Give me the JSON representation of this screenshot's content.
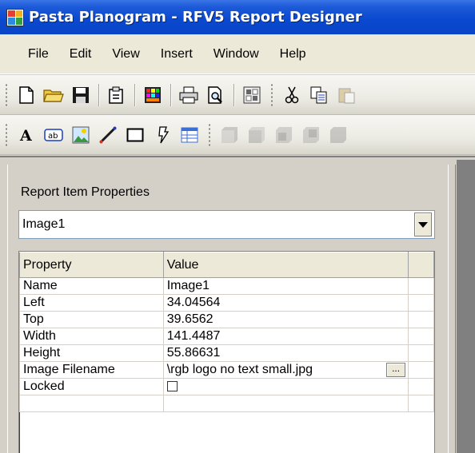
{
  "window": {
    "title": "Pasta Planogram - RFV5 Report Designer"
  },
  "menu": [
    "File",
    "Edit",
    "View",
    "Insert",
    "Window",
    "Help"
  ],
  "toolbar1": {
    "icons": [
      "new-document-icon",
      "open-folder-icon",
      "save-icon",
      "properties-icon",
      "color-palette-icon",
      "print-icon",
      "print-preview-icon",
      "grid-icon",
      "cut-icon",
      "copy-icon",
      "paste-icon"
    ]
  },
  "toolbar2": {
    "icons": [
      "text-tool-icon",
      "textbox-tool-icon",
      "image-tool-icon",
      "line-tool-icon",
      "rectangle-tool-icon",
      "barcode-tool-icon",
      "table-tool-icon",
      "bring-to-front-icon",
      "send-to-back-icon",
      "bring-forward-icon",
      "send-backward-icon",
      "group-icon"
    ]
  },
  "panel": {
    "label": "Report Item Properties",
    "selected_item": "Image1",
    "grid": {
      "headers": [
        "Property",
        "Value"
      ],
      "rows": [
        {
          "property": "Name",
          "value": "Image1"
        },
        {
          "property": "Left",
          "value": "34.04564"
        },
        {
          "property": "Top",
          "value": "39.6562"
        },
        {
          "property": "Width",
          "value": "141.4487"
        },
        {
          "property": "Height",
          "value": "55.86631"
        },
        {
          "property": "Image Filename",
          "value": "\\rgb logo no text small.jpg",
          "has_button": true,
          "button_label": "..."
        },
        {
          "property": "Locked",
          "value": "",
          "checkbox": false
        }
      ]
    }
  }
}
